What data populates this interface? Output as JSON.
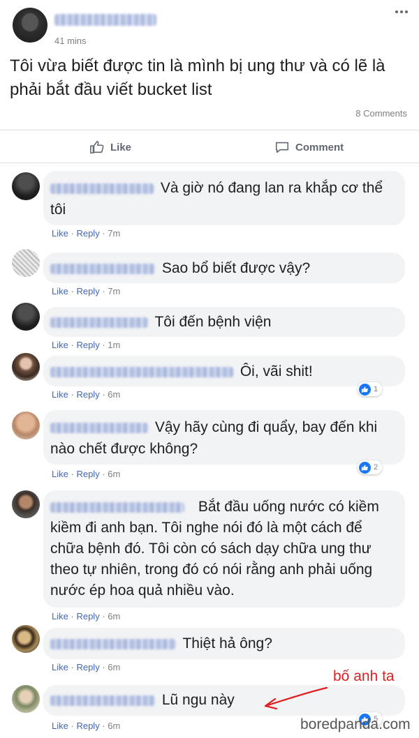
{
  "post": {
    "time": "41 mins",
    "text": "Tôi vừa biết được tin là mình bị ung thư và có lẽ là phải bắt đầu viết bucket list",
    "comments_count": "8 Comments",
    "like_label": "Like",
    "comment_label": "Comment"
  },
  "comment_actions": {
    "like": "Like",
    "reply": "Reply",
    "sep": "·"
  },
  "comments": [
    {
      "text": "Và giờ nó đang lan ra khắp cơ thể tôi",
      "time": "7m"
    },
    {
      "text": "Sao bổ biết được vậy?",
      "time": "7m"
    },
    {
      "text": "Tôi đến bệnh viện",
      "time": "1m"
    },
    {
      "text": "Ôi, vãi shit!",
      "time": "6m",
      "reactions": "1"
    },
    {
      "text": "Vậy hãy cùng đi quẩy, bay đến khi nào chết được không?",
      "time": "6m",
      "reactions": "2"
    },
    {
      "text": "Bắt đầu uống nước có kiềm kiềm đi anh bạn. Tôi nghe nói đó là một cách để chữa bệnh đó. Tôi còn có sách dạy chữa ung thư theo tự nhiên, trong đó có nói rằng anh phải uống nước ép hoa quả nhiều vào.",
      "time": "6m"
    },
    {
      "text": "Thiệt hả ông?",
      "time": "6m"
    },
    {
      "text": "Lũ ngu này",
      "time": "6m",
      "reactions": "5"
    }
  ],
  "annotation": "bố anh ta",
  "watermark": "boredpanda.com",
  "colors": {
    "link": "#4267b2",
    "bubble": "#f2f3f5",
    "like_badge": "#1877f2",
    "annotation": "#e02020"
  }
}
